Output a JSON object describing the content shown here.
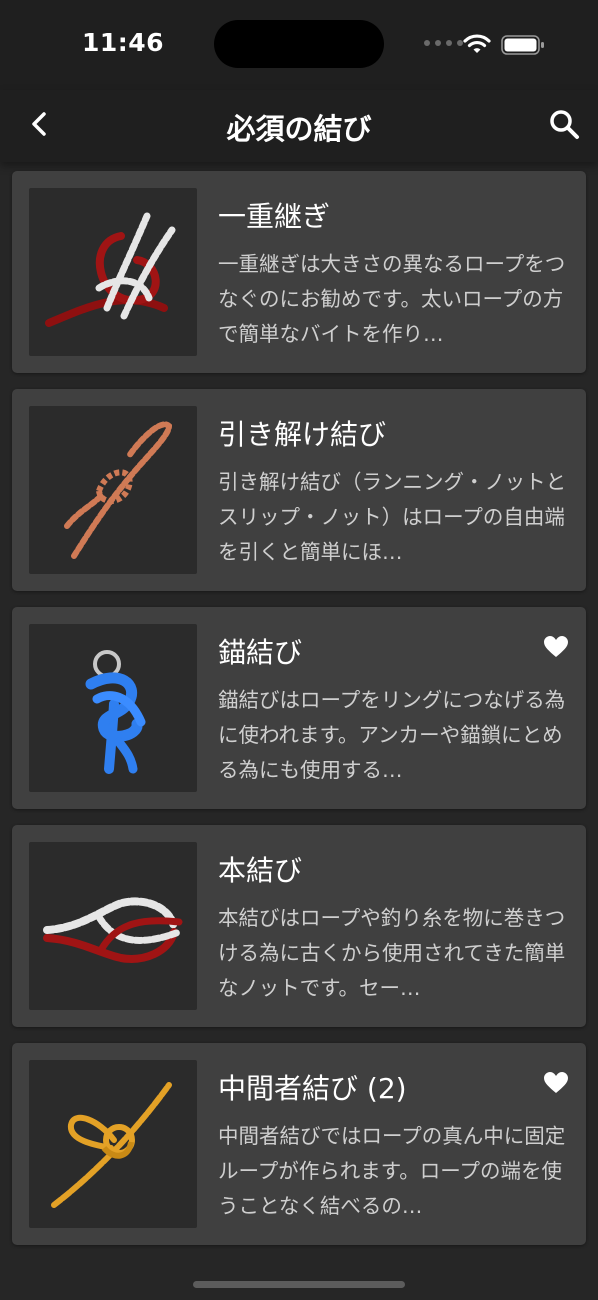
{
  "status": {
    "time": "11:46"
  },
  "nav": {
    "title": "必須の結び",
    "back_icon": "chevron-left-icon",
    "search_icon": "search-icon"
  },
  "knots": [
    {
      "title": "一重継ぎ",
      "description": "一重継ぎは大きさの異なるロープをつなぐのにお勧めです。太いロープの方で簡単なバイトを作り…",
      "favorite": false,
      "rope_colors": [
        "#a01414",
        "#e6e6e6"
      ]
    },
    {
      "title": "引き解け結び",
      "description": "引き解け結び（ランニング・ノットとスリップ・ノット）はロープの自由端を引くと簡単にほ…",
      "favorite": false,
      "rope_colors": [
        "#d07a55"
      ]
    },
    {
      "title": "錨結び",
      "description": "錨結びはロープをリングにつなげる為に使われます。アンカーや錨鎖にとめる為にも使用する…",
      "favorite": true,
      "rope_colors": [
        "#2f7ff0"
      ]
    },
    {
      "title": "本結び",
      "description": "本結びはロープや釣り糸を物に巻きつける為に古くから使用されてきた簡単なノットです。セー…",
      "favorite": false,
      "rope_colors": [
        "#a01414",
        "#e6e6e6"
      ]
    },
    {
      "title": "中間者結び (2)",
      "description": "中間者結びではロープの真ん中に固定ループが作られます。ロープの端を使うことなく結べるの…",
      "favorite": true,
      "rope_colors": [
        "#e3a126"
      ]
    }
  ]
}
